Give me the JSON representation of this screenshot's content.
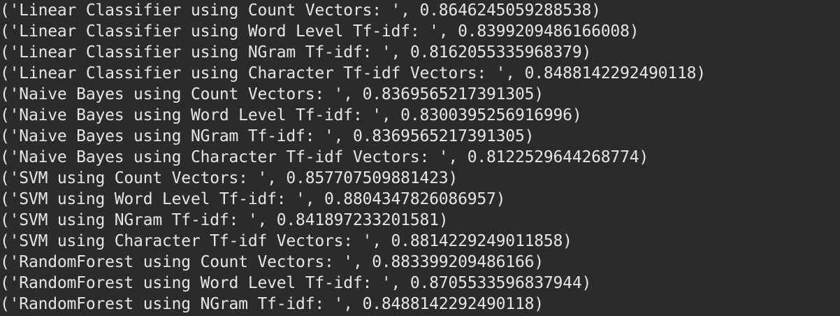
{
  "terminal": {
    "lines": [
      "('Linear Classifier using Count Vectors: ', 0.8646245059288538)",
      "('Linear Classifier using Word Level Tf-idf: ', 0.8399209486166008)",
      "('Linear Classifier using NGram Tf-idf: ', 0.8162055335968379)",
      "('Linear Classifier using Character Tf-idf Vectors: ', 0.8488142292490118)",
      "('Naive Bayes using Count Vectors: ', 0.8369565217391305)",
      "('Naive Bayes using Word Level Tf-idf: ', 0.8300395256916996)",
      "('Naive Bayes using NGram Tf-idf: ', 0.8369565217391305)",
      "('Naive Bayes using Character Tf-idf Vectors: ', 0.8122529644268774)",
      "('SVM using Count Vectors: ', 0.857707509881423)",
      "('SVM using Word Level Tf-idf: ', 0.8804347826086957)",
      "('SVM using NGram Tf-idf: ', 0.841897233201581)",
      "('SVM using Character Tf-idf Vectors: ', 0.8814229249011858)",
      "('RandomForest using Count Vectors: ', 0.883399209486166)",
      "('RandomForest using Word Level Tf-idf: ', 0.8705533596837944)",
      "('RandomForest using NGram Tf-idf: ', 0.8488142292490118)"
    ]
  }
}
